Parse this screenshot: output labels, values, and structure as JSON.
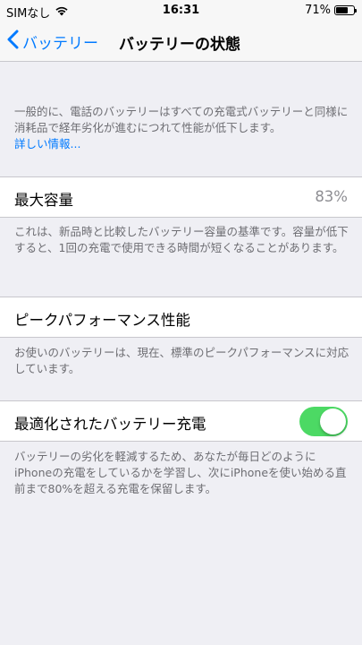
{
  "status_bar": {
    "carrier": "SIMなし",
    "time": "16:31",
    "battery_percent": "71%",
    "battery_level": 0.71,
    "wifi_icon": "wifi-icon"
  },
  "nav": {
    "back_label": "バッテリー",
    "title": "バッテリーの状態"
  },
  "intro": {
    "text": "一般的に、電話のバッテリーはすべての充電式バッテリーと同様に消耗品で経年劣化が進むにつれて性能が低下します。",
    "link": "詳しい情報..."
  },
  "max_capacity": {
    "label": "最大容量",
    "value": "83%",
    "footer": "これは、新品時と比較したバッテリー容量の基準です。容量が低下すると、1回の充電で使用できる時間が短くなることがあります。"
  },
  "peak_performance": {
    "label": "ピークパフォーマンス性能",
    "footer": "お使いのバッテリーは、現在、標準のピークパフォーマンスに対応しています。"
  },
  "optimized_charging": {
    "label": "最適化されたバッテリー充電",
    "enabled": true,
    "footer": "バッテリーの劣化を軽減するため、あなたが毎日どのようにiPhoneの充電をしているかを学習し、次にiPhoneを使い始める直前まで80%を超える充電を保留します。"
  },
  "colors": {
    "accent": "#007aff",
    "toggle_on": "#4cd964",
    "background": "#efeff4"
  }
}
